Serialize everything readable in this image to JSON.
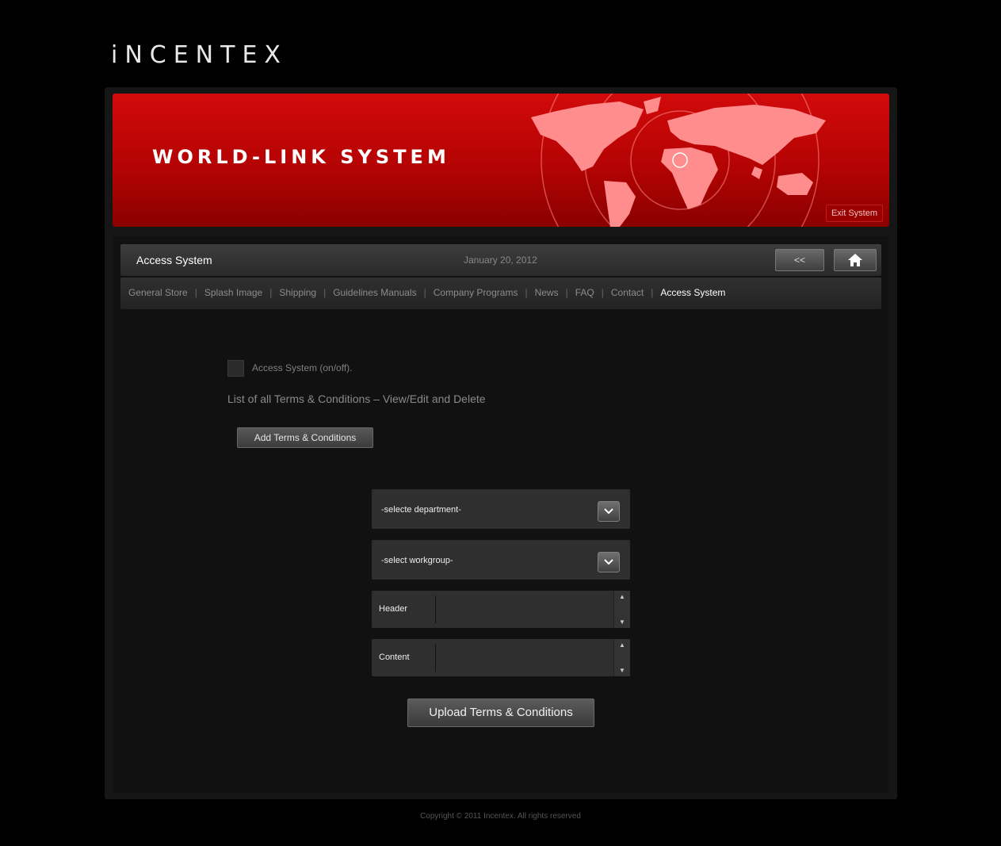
{
  "brand": {
    "logo": "iNCENTEX"
  },
  "banner": {
    "title": "WORLD-LINK SYSTEM",
    "exit_label": "Exit System"
  },
  "topbar": {
    "title": "Access System",
    "date": "January 20, 2012",
    "back_label": "<<"
  },
  "nav": {
    "items": [
      {
        "label": "General Store"
      },
      {
        "label": "Splash Image"
      },
      {
        "label": "Shipping"
      },
      {
        "label": "Guidelines Manuals"
      },
      {
        "label": "Company Programs"
      },
      {
        "label": "News"
      },
      {
        "label": "FAQ"
      },
      {
        "label": "Contact"
      },
      {
        "label": "Access System",
        "active": true
      }
    ]
  },
  "main": {
    "checkbox_label": "Access System (on/off).",
    "list_link": "List of all Terms & Conditions – View/Edit and Delete",
    "add_button": "Add Terms & Conditions",
    "department_select": "-selecte department-",
    "workgroup_select": "-select workgroup-",
    "header_label": "Header",
    "content_label": "Content",
    "upload_button": "Upload Terms & Conditions"
  },
  "footer": {
    "copyright": "Copyright © 2011 Incentex. All rights reserved"
  },
  "colors": {
    "banner_red": "#c40404",
    "background": "#000000",
    "panel": "#111111"
  }
}
